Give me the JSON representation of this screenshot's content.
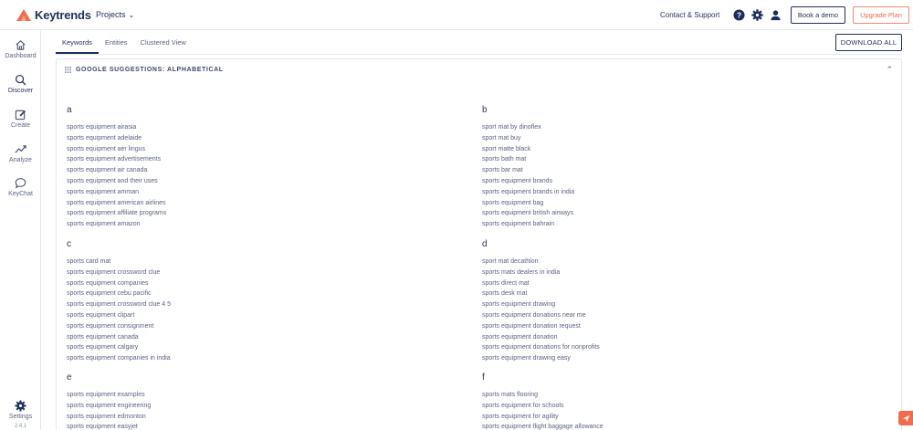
{
  "app": {
    "name": "Keytrends",
    "projects_label": "Projects",
    "contact_label": "Contact & Support",
    "demo_label": "Book a demo",
    "upgrade_label": "Upgrade Plan",
    "accent_color": "#ef6d4a",
    "brand_color": "#1f2d5c"
  },
  "sidebar": {
    "items": [
      {
        "label": "Dashboard",
        "icon": "home-icon"
      },
      {
        "label": "Discover",
        "icon": "search-icon"
      },
      {
        "label": "Create",
        "icon": "edit-icon"
      },
      {
        "label": "Analyze",
        "icon": "trend-icon"
      },
      {
        "label": "KeyChat",
        "icon": "chat-icon"
      }
    ],
    "settings_label": "Settings",
    "version": "2.4.1"
  },
  "tabs": [
    {
      "label": "Keywords",
      "active": true
    },
    {
      "label": "Entities",
      "active": false
    },
    {
      "label": "Clustered View",
      "active": false
    }
  ],
  "download_label": "DOWNLOAD ALL",
  "card": {
    "title": "GOOGLE SUGGESTIONS: ALPHABETICAL"
  },
  "groups": [
    {
      "letter": "a",
      "keywords": [
        "sports equipment airasia",
        "sports equipment adelaide",
        "sports equipment aer lingus",
        "sports equipment advertisements",
        "sports equipment air canada",
        "sports equipment and their uses",
        "sports equipment amman",
        "sports equipment american airlines",
        "sports equipment affiliate programs",
        "sports equipment amazon"
      ]
    },
    {
      "letter": "b",
      "keywords": [
        "sport mat by dinoflex",
        "sport mat buy",
        "sport matte black",
        "sports bath mat",
        "sports bar mat",
        "sports equipment brands",
        "sports equipment brands in india",
        "sports equipment bag",
        "sports equipment british airways",
        "sports equipment bahrain"
      ]
    },
    {
      "letter": "c",
      "keywords": [
        "sports card mat",
        "sports equipment crossword clue",
        "sports equipment companies",
        "sports equipment cebu pacific",
        "sports equipment crossword clue 4 5",
        "sports equipment clipart",
        "sports equipment consignment",
        "sports equipment canada",
        "sports equipment calgary",
        "sports equipment companies in india"
      ]
    },
    {
      "letter": "d",
      "keywords": [
        "sport mat decathlon",
        "sports mats dealers in india",
        "sports direct mat",
        "sports desk mat",
        "sports equipment drawing",
        "sports equipment donations near me",
        "sports equipment donation request",
        "sports equipment donation",
        "sports equipment donations for nonprofits",
        "sports equipment drawing easy"
      ]
    },
    {
      "letter": "e",
      "keywords": [
        "sports equipment examples",
        "sports equipment engineering",
        "sports equipment edmonton",
        "sports equipment easyjet"
      ]
    },
    {
      "letter": "f",
      "keywords": [
        "sports mats flooring",
        "sports equipment for schools",
        "sports equipment for agility",
        "sports equipment flight baggage allowance"
      ]
    }
  ]
}
